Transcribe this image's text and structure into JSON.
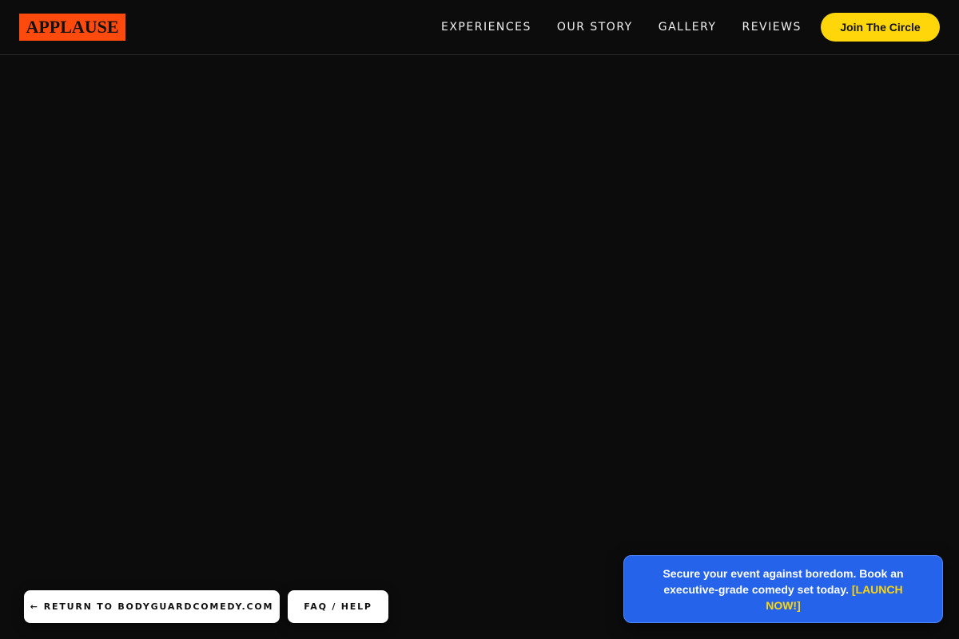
{
  "header": {
    "logo": "APPLAUSE",
    "nav": [
      {
        "label": "EXPERIENCES"
      },
      {
        "label": "OUR STORY"
      },
      {
        "label": "GALLERY"
      },
      {
        "label": "REVIEWS"
      }
    ],
    "cta_label": "Join The Circle"
  },
  "footer_buttons": {
    "return_arrow": "←",
    "return_label": "RETURN TO BODYGUARDCOMEDY.COM",
    "faq_label": "FAQ / HELP"
  },
  "promo": {
    "text": "Secure your event against boredom. Book an executive-grade comedy set today. ",
    "cta": "[LAUNCH NOW!]"
  },
  "colors": {
    "background": "#0c0c0c",
    "logo_bg": "#ff4a0d",
    "cta_yellow": "#ffd60a",
    "promo_blue": "#2563eb"
  }
}
